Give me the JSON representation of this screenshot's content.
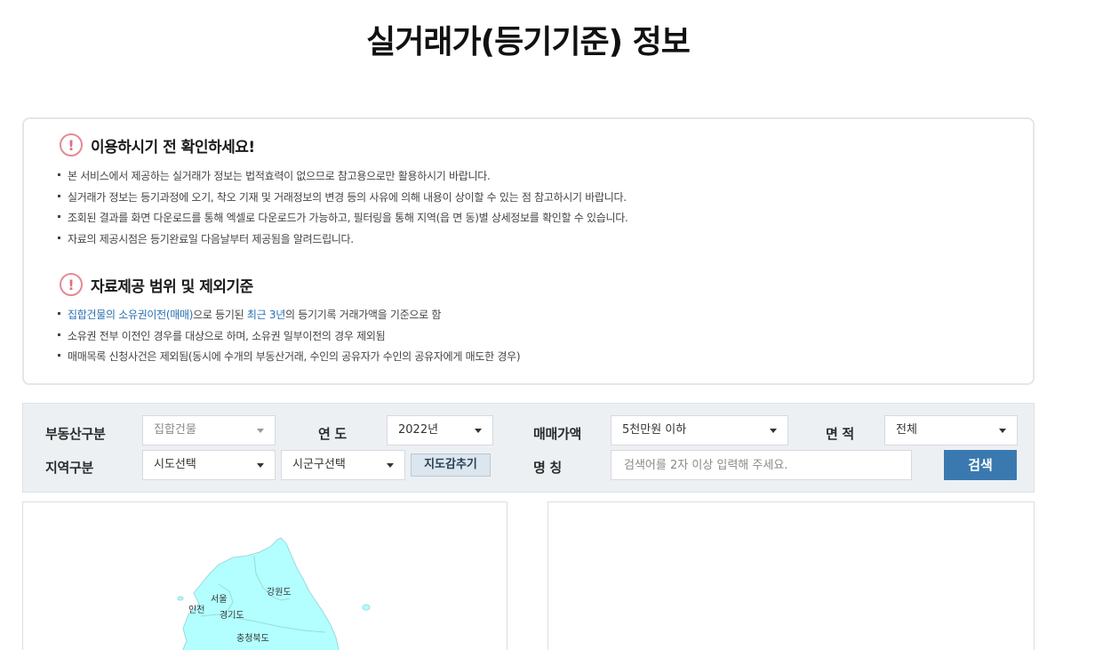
{
  "page": {
    "title": "실거래가(등기기준) 정보"
  },
  "notice": {
    "heading": "이용하시기 전 확인하세요!",
    "items": [
      "본 서비스에서 제공하는 실거래가 정보는 법적효력이 없으므로 참고용으로만 활용하시기 바랍니다.",
      "실거래가 정보는 등기과정에 오기, 착오 기재 및 거래정보의 변경 등의 사유에 의해 내용이 상이할 수 있는 점 참고하시기 바랍니다.",
      "조회된 결과를 화면 다운로드를 통해 엑셀로 다운로드가 가능하고, 필터링을 통해 지역(읍 면 동)별 상세정보를 확인할 수 있습니다.",
      "자료의 제공시점은 등기완료일 다음날부터 제공됨을 알려드립니다."
    ]
  },
  "scope": {
    "heading": "자료제공 범위 및 제외기준",
    "item1": {
      "hl1": "집합건물의 소유권이전(매매)",
      "text1": "으로 등기된 ",
      "hl2": "최근 3년",
      "text2": "의 등기기록 거래가액을 기준으로 함"
    },
    "items": [
      "소유권 전부 이전인 경우를 대상으로 하며, 소유권 일부이전의 경우 제외됨",
      "매매목록 신청사건은 제외됨(동시에 수개의 부동산거래, 수인의 공유자가 수인의 공유자에게 매도한 경우)"
    ]
  },
  "search": {
    "property_type": {
      "label": "부동산구분",
      "value": "집합건물"
    },
    "year": {
      "label": "연 도",
      "value": "2022년"
    },
    "price": {
      "label": "매매가액",
      "value": "5천만원 이하"
    },
    "area": {
      "label": "면 적",
      "value": "전체"
    },
    "region": {
      "label": "지역구분",
      "sido": "시도선택",
      "sigungu": "시군구선택"
    },
    "map_toggle": "지도감추기",
    "name": {
      "label": "명 칭",
      "placeholder": "검색어를 2자 이상 입력해 주세요."
    },
    "search_button": "검색"
  },
  "map": {
    "labels": {
      "seoul": "서울",
      "incheon": "인천",
      "gyeonggi": "경기도",
      "gangwon": "강원도",
      "chungbuk": "충청북도"
    },
    "colors": {
      "land": "#b3ffff",
      "border": "#9adada"
    }
  },
  "colors": {
    "accent": "#3a79b0",
    "alert": "#e0707e",
    "highlight": "#2a6fb3"
  }
}
